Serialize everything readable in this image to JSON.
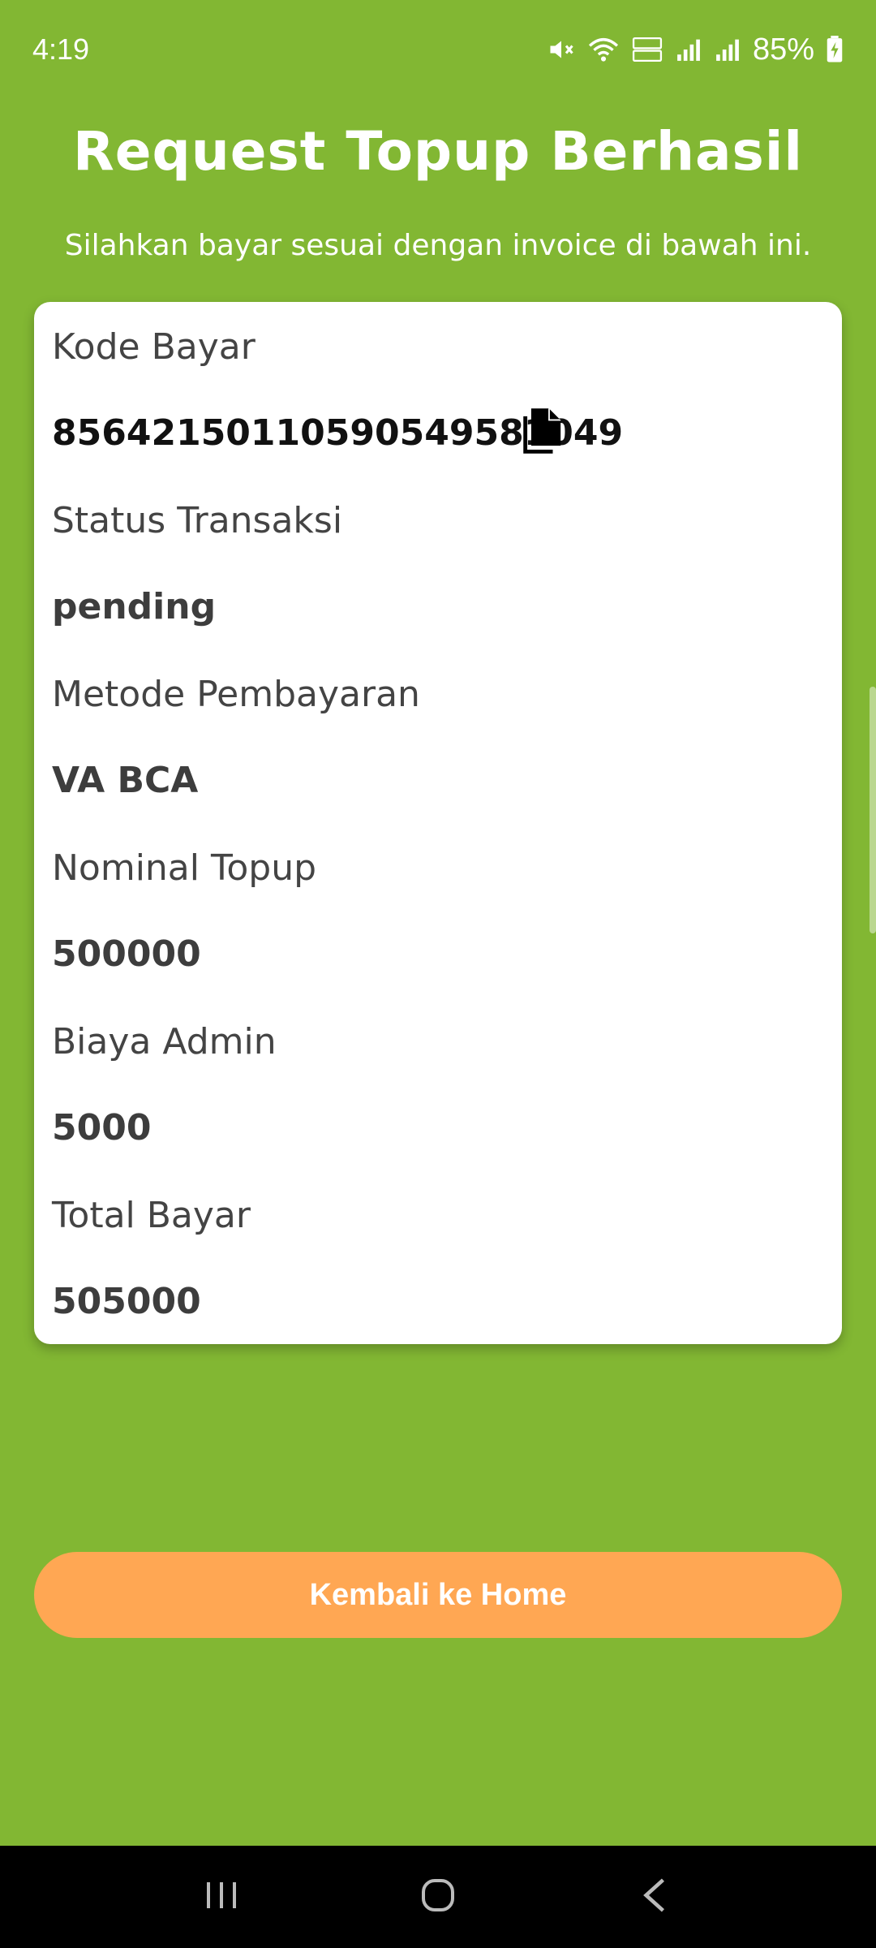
{
  "status_bar": {
    "time": "4:19",
    "battery": "85%"
  },
  "header": {
    "title": "Request Topup Berhasil",
    "subtitle": "Silahkan bayar sesuai dengan invoice di bawah ini."
  },
  "invoice": {
    "kode_bayar_label": "Kode Bayar",
    "kode_bayar_value": "85642150110590549581049",
    "status_label": "Status Transaksi",
    "status_value": "pending",
    "metode_label": "Metode Pembayaran",
    "metode_value": "VA BCA",
    "nominal_label": "Nominal Topup",
    "nominal_value": "500000",
    "admin_label": "Biaya Admin",
    "admin_value": "5000",
    "total_label": "Total Bayar",
    "total_value": "505000"
  },
  "actions": {
    "home_label": "Kembali ke Home"
  },
  "colors": {
    "background": "#82b733",
    "button": "#ffa753",
    "card": "#ffffff"
  },
  "icons": {
    "copy": "copy-icon",
    "mute": "mute-icon",
    "wifi": "wifi-icon",
    "signal": "signal-icon",
    "battery": "battery-icon"
  }
}
